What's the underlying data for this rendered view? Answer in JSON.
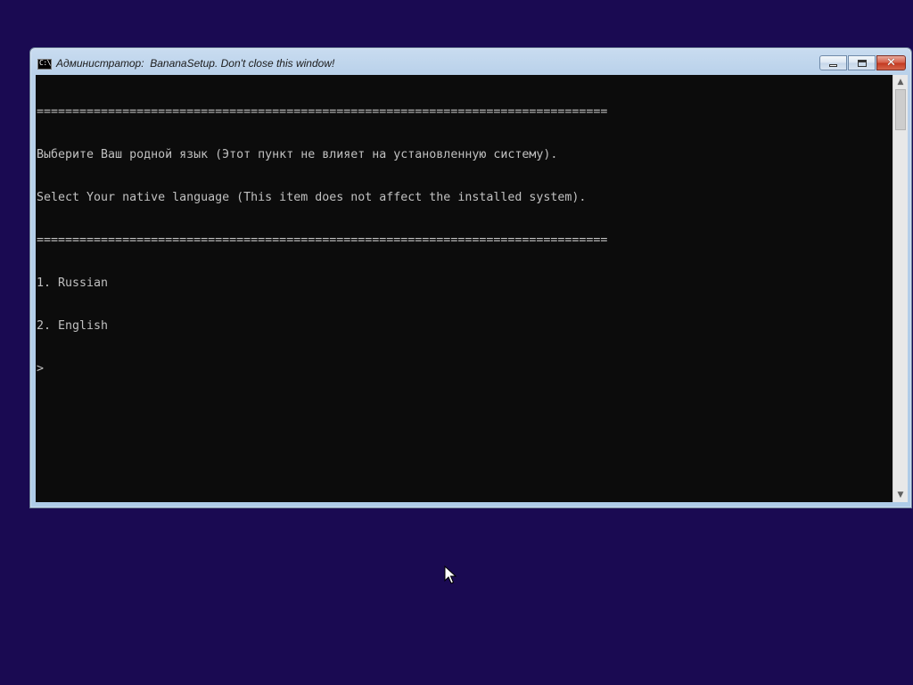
{
  "window": {
    "title": "Администратор:  BananaSetup. Don't close this window!",
    "icon_label": "C:\\"
  },
  "caption_buttons": {
    "minimize": "minimize-icon",
    "maximize": "maximize-icon",
    "close": "✕"
  },
  "console": {
    "lines": [
      "================================================================================",
      "Выберите Ваш родной язык (Этот пункт не влияет на установленную систему).",
      "Select Your native language (This item does not affect the installed system).",
      "================================================================================",
      "1. Russian",
      "2. English",
      ">"
    ],
    "text_color": "#c0c0c0",
    "background": "#0c0c0c"
  },
  "scrollbar": {
    "up_arrow": "▲",
    "down_arrow": "▼"
  },
  "desktop": {
    "background": "#1a0a52"
  }
}
